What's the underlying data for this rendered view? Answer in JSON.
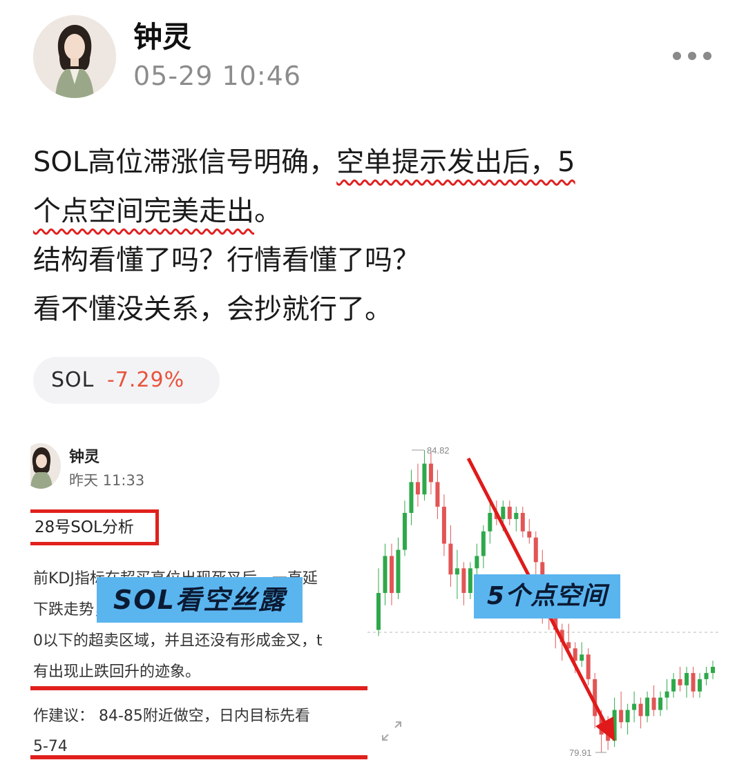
{
  "header": {
    "author_name": "钟灵",
    "timestamp": "05-29 10:46",
    "more_icon": "more-horizontal-icon"
  },
  "post": {
    "line1_plain": "SOL高位滞涨信号明确，",
    "line1_marked": "空单提示发出后，5",
    "line2_marked": "个点空间完美走出",
    "line2_end": "。",
    "line3": "结构看懂了吗？行情看懂了吗？",
    "line4": "看不懂没关系，会抄就行了。",
    "underline_color": "#e02020"
  },
  "ticker_chip": {
    "symbol": "SOL",
    "change": "-7.29%",
    "change_color": "#e8533c"
  },
  "attached_image": {
    "quoted_post": {
      "author_name": "钟灵",
      "timestamp": "昨天 11:33",
      "framed_title": "28号SOL分析",
      "paragraph_lines": [
        "前KDJ指标在超买高位出现死叉后，一直延",
        "下跌走势，目前KDJ指标已经跌到",
        "0以下的超卖区域，并且还没有形成金叉，t",
        "有出现止跌回升的迹象。"
      ],
      "advice_lines": [
        "作建议：  84-85附近做空，日内目标先看",
        "5-74"
      ]
    },
    "banner_left": "SOL看空丝露",
    "banner_right": "5个点空间",
    "chart": {
      "high_label": "84.82",
      "low_label": "79.91",
      "up_color": "#2ea84a",
      "down_color": "#e25555",
      "arrow_color": "#e01a1a",
      "expand_icon": "expand-icon"
    }
  },
  "chart_data": {
    "type": "candlestick",
    "high": 84.82,
    "low": 79.91,
    "annotations": [
      "84.82",
      "79.91",
      "5个点空间"
    ],
    "ohlc": [
      [
        81.9,
        82.9,
        81.8,
        82.5
      ],
      [
        82.5,
        83.3,
        82.3,
        83.1
      ],
      [
        83.1,
        83.3,
        82.3,
        82.5
      ],
      [
        82.5,
        83.4,
        82.4,
        83.2
      ],
      [
        83.2,
        84.0,
        83.1,
        83.8
      ],
      [
        83.8,
        84.5,
        83.6,
        84.3
      ],
      [
        84.3,
        84.6,
        83.9,
        84.1
      ],
      [
        84.1,
        84.82,
        84.0,
        84.6
      ],
      [
        84.6,
        84.8,
        84.1,
        84.3
      ],
      [
        84.3,
        84.5,
        83.7,
        83.9
      ],
      [
        83.9,
        84.1,
        83.1,
        83.3
      ],
      [
        83.3,
        83.6,
        82.6,
        82.8
      ],
      [
        82.8,
        83.2,
        82.4,
        82.9
      ],
      [
        82.9,
        83.0,
        82.3,
        82.5
      ],
      [
        82.5,
        83.0,
        82.4,
        82.9
      ],
      [
        82.9,
        83.3,
        82.6,
        83.1
      ],
      [
        83.1,
        83.6,
        82.9,
        83.5
      ],
      [
        83.5,
        84.0,
        83.3,
        83.8
      ],
      [
        83.8,
        84.0,
        83.6,
        83.7
      ],
      [
        83.7,
        84.0,
        83.5,
        83.9
      ],
      [
        83.9,
        84.0,
        83.6,
        83.7
      ],
      [
        83.7,
        83.9,
        83.5,
        83.8
      ],
      [
        83.8,
        83.9,
        83.4,
        83.5
      ],
      [
        83.5,
        83.7,
        83.3,
        83.4
      ],
      [
        83.4,
        83.5,
        82.8,
        83.0
      ],
      [
        83.0,
        83.2,
        82.0,
        82.3
      ],
      [
        82.3,
        82.6,
        81.9,
        82.1
      ],
      [
        82.1,
        82.3,
        81.6,
        81.9
      ],
      [
        81.9,
        82.0,
        81.4,
        81.7
      ],
      [
        81.7,
        82.0,
        81.5,
        81.6
      ],
      [
        81.6,
        81.7,
        81.2,
        81.4
      ],
      [
        81.4,
        81.7,
        81.3,
        81.5
      ],
      [
        81.5,
        81.6,
        81.0,
        81.1
      ],
      [
        81.1,
        81.2,
        80.3,
        80.5
      ],
      [
        80.5,
        80.6,
        79.91,
        80.2
      ],
      [
        80.2,
        80.5,
        79.95,
        80.1
      ],
      [
        80.1,
        80.8,
        80.0,
        80.6
      ],
      [
        80.6,
        80.9,
        80.3,
        80.4
      ],
      [
        80.4,
        80.7,
        80.2,
        80.6
      ],
      [
        80.6,
        80.9,
        80.4,
        80.7
      ],
      [
        80.7,
        80.8,
        80.3,
        80.5
      ],
      [
        80.5,
        80.9,
        80.4,
        80.8
      ],
      [
        80.8,
        81.0,
        80.5,
        80.6
      ],
      [
        80.6,
        80.9,
        80.5,
        80.8
      ],
      [
        80.8,
        81.1,
        80.6,
        80.9
      ],
      [
        80.9,
        81.2,
        80.8,
        81.1
      ],
      [
        81.1,
        81.3,
        80.9,
        81.0
      ],
      [
        81.0,
        81.3,
        80.8,
        81.2
      ],
      [
        81.2,
        81.3,
        80.8,
        80.9
      ],
      [
        80.9,
        81.2,
        80.8,
        81.1
      ],
      [
        81.1,
        81.3,
        81.0,
        81.2
      ],
      [
        81.2,
        81.4,
        81.1,
        81.3
      ]
    ]
  }
}
